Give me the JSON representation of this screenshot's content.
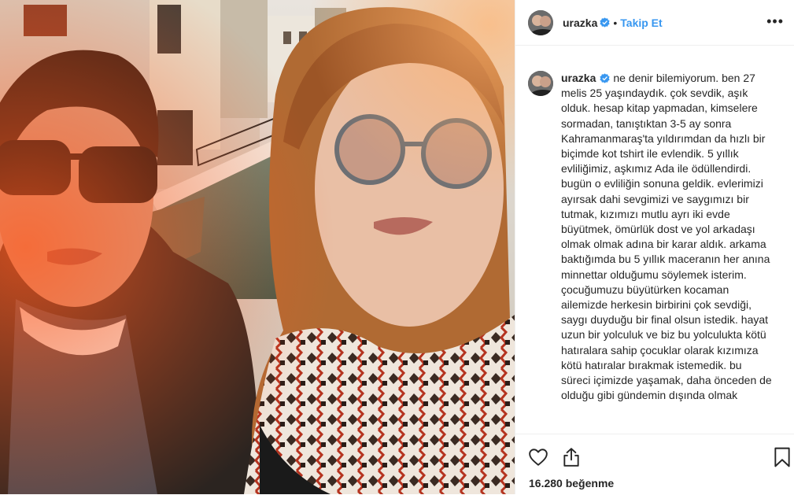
{
  "post": {
    "username": "urazka",
    "follow_label": "Takip Et",
    "separator": "•",
    "more_label": "•••",
    "caption": "ne denir bilemiyorum. ben 27 melis 25 yaşındaydık. çok sevdik, aşık olduk. hesap kitap yapmadan, kimselere sormadan, tanıştıktan 3-5 ay sonra Kahramanmaraş'ta yıldırımdan da hızlı bir biçimde kot tshirt ile evlendik. 5 yıllık evliliğimiz, aşkımız Ada ile ödüllendirdi. bugün o evliliğin sonuna geldik. evlerimizi ayırsak dahi sevgimizi ve saygımızı bir tutmak, kızımızı mutlu ayrı iki evde büyütmek, ömürlük dost ve yol arkadaşı olmak olmak adına bir karar aldık. arkama baktığımda bu 5 yıllık maceranın her anına minnettar olduğumu söylemek isterim. çocuğumuzu büyütürken kocaman ailemizde herkesin birbirini çok sevdiği, saygı duyduğu bir final olsun istedik. hayat uzun bir yolculuk ve biz bu yolculukta kötü hatıralara sahip çocuklar olarak kızımıza kötü hatıralar bırakmak istemedik. bu süreci içimizde yaşamak, daha önceden de olduğu gibi gündemin dışında olmak",
    "likes_text": "16.280 beğenme"
  },
  "colors": {
    "follow_blue": "#3897f0",
    "verified_blue": "#3897f0",
    "text": "#262626",
    "border": "#efefef"
  },
  "icons": {
    "like": "heart-icon",
    "share": "share-icon",
    "save": "bookmark-icon",
    "verified": "verified-badge-icon",
    "more": "more-options-icon"
  }
}
